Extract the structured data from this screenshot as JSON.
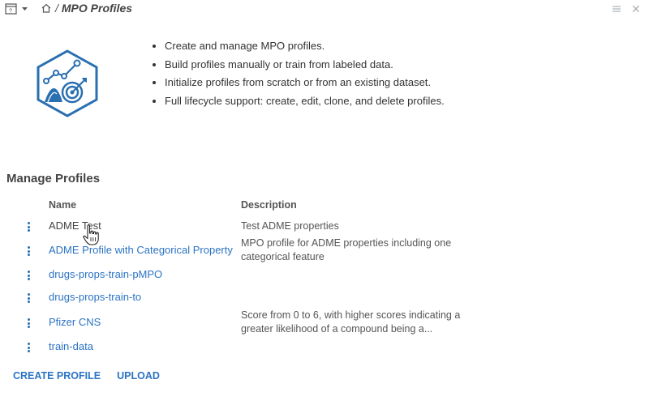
{
  "breadcrumb": {
    "separator": "/",
    "title": "MPO Profiles"
  },
  "features": [
    "Create and manage MPO profiles.",
    "Build profiles manually or train from labeled data.",
    "Initialize profiles from scratch or from an existing dataset.",
    "Full lifecycle support: create, edit, clone, and delete profiles."
  ],
  "section_title": "Manage Profiles",
  "table": {
    "headers": {
      "name": "Name",
      "description": "Description"
    },
    "rows": [
      {
        "name": "ADME Test",
        "description": "Test ADME properties"
      },
      {
        "name": "ADME Profile with Categorical Property",
        "description": "MPO profile for ADME properties including one categorical feature"
      },
      {
        "name": "drugs-props-train-pMPO",
        "description": ""
      },
      {
        "name": "drugs-props-train-to",
        "description": ""
      },
      {
        "name": "Pfizer CNS",
        "description": "Score from 0 to 6, with higher scores indicating a greater likelihood of a compound being a..."
      },
      {
        "name": "train-data",
        "description": ""
      }
    ]
  },
  "actions": {
    "create": "CREATE PROFILE",
    "upload": "UPLOAD"
  },
  "icons": {
    "window": "window-menu-icon",
    "home": "home-icon",
    "menu": "hamburger-menu-icon",
    "close": "close-icon",
    "logo": "mpo-target-logo-icon",
    "row_menu": "kebab-menu-icon",
    "cursor": "hand-pointer-cursor-icon"
  },
  "colors": {
    "accent": "#2b73c4",
    "logo": "#2a6fb0",
    "text": "#3a3a3a",
    "muted_icon": "#aab0b8"
  }
}
